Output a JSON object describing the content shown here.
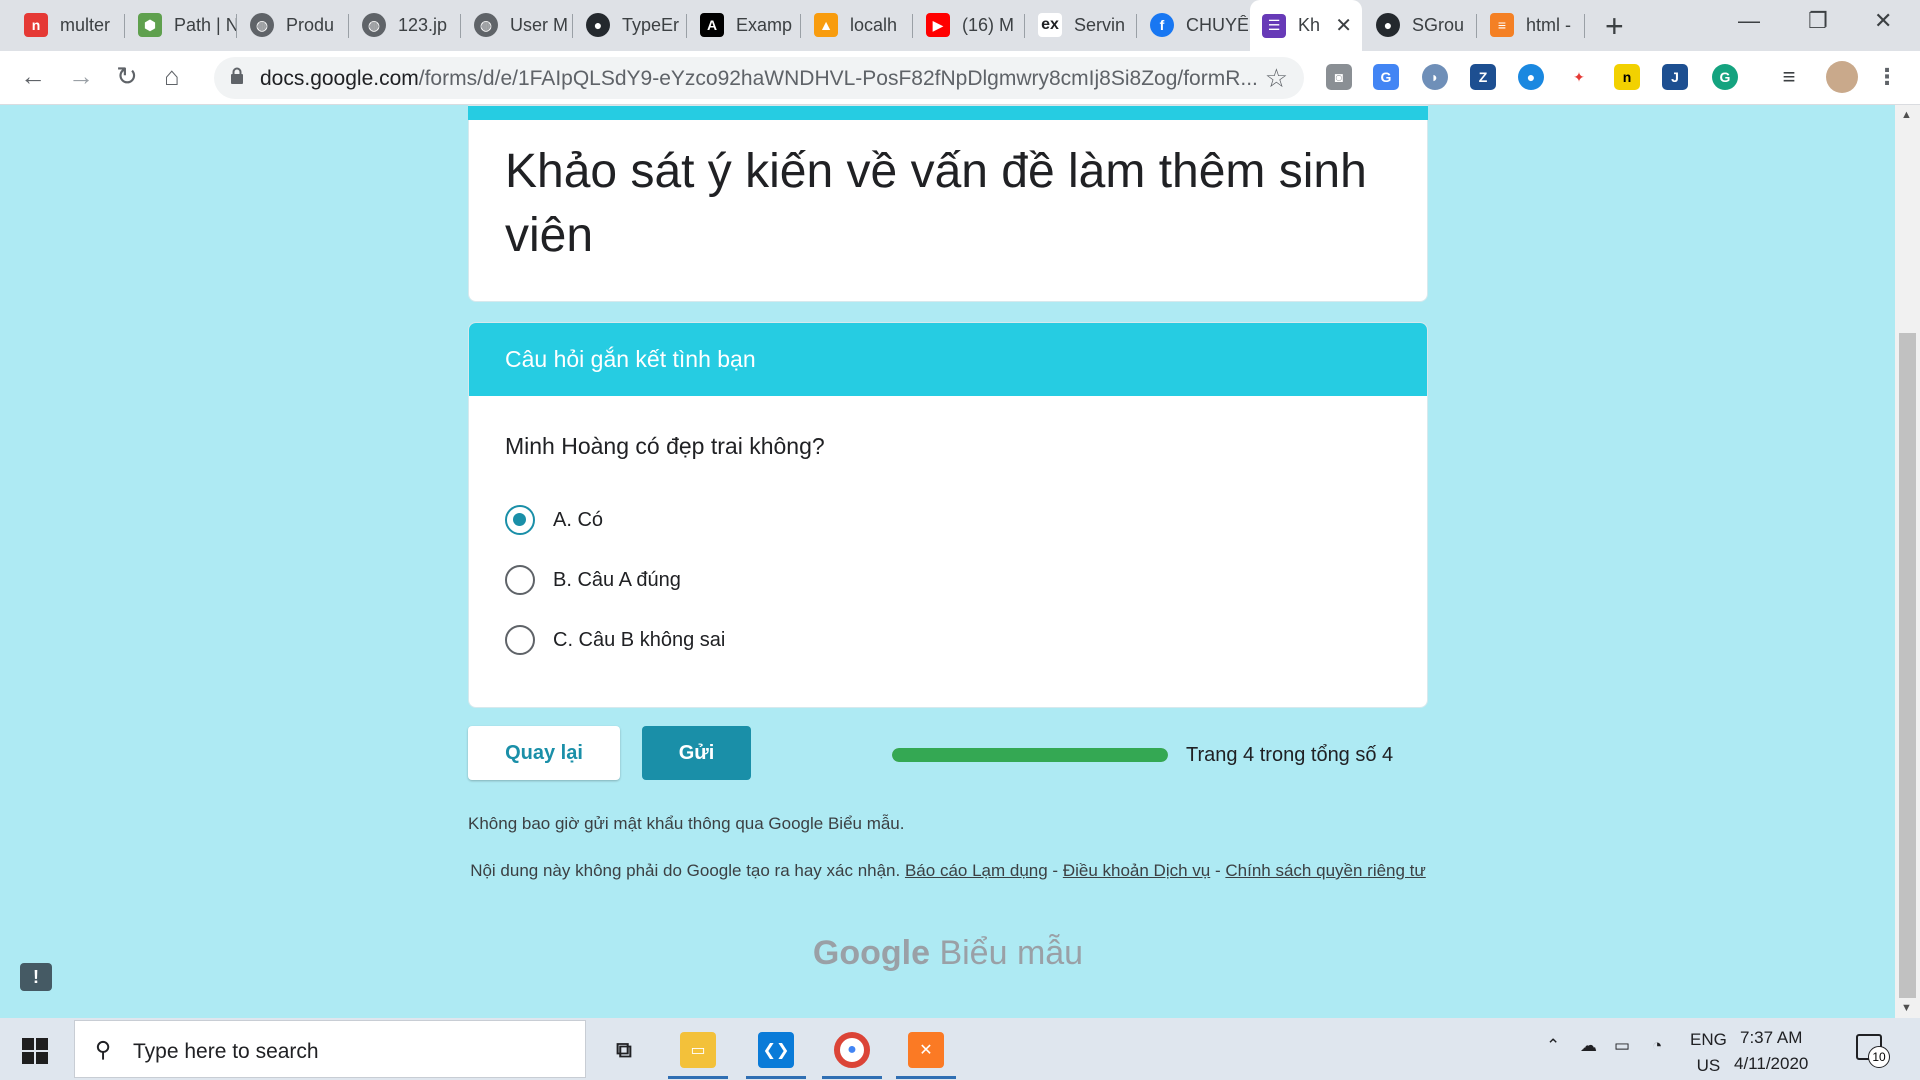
{
  "browser": {
    "tabs": [
      {
        "title": "multer",
        "icon": "red-brand-icon",
        "color": "#e53935",
        "glyph": "n"
      },
      {
        "title": "Path | N",
        "icon": "nodejs-icon",
        "color": "#5fa04e",
        "glyph": "⬢"
      },
      {
        "title": "Produ",
        "icon": "globe-icon",
        "color": "#5f6368",
        "glyph": "◍"
      },
      {
        "title": "123.jp",
        "icon": "globe-icon",
        "color": "#5f6368",
        "glyph": "◍"
      },
      {
        "title": "User M",
        "icon": "globe-icon",
        "color": "#5f6368",
        "glyph": "◍"
      },
      {
        "title": "TypeEr",
        "icon": "github-icon",
        "color": "#24292e",
        "glyph": "●"
      },
      {
        "title": "Examp",
        "icon": "a-brand-icon",
        "color": "#000000",
        "glyph": "A"
      },
      {
        "title": "localh",
        "icon": "phpmyadmin-icon",
        "color": "#f89c0e",
        "glyph": "▲"
      },
      {
        "title": "(16) M",
        "icon": "youtube-icon",
        "color": "#ff0000",
        "glyph": "▶"
      },
      {
        "title": "Servin",
        "icon": "ex-icon",
        "color": "#ffffff",
        "glyph": "ex"
      },
      {
        "title": "CHUYÊ",
        "icon": "facebook-icon",
        "color": "#1877f2",
        "glyph": "f"
      },
      {
        "title": "Kh",
        "icon": "google-forms-icon",
        "color": "#673ab7",
        "glyph": "☰",
        "active": true
      },
      {
        "title": "SGrou",
        "icon": "github-icon",
        "color": "#24292e",
        "glyph": "●"
      },
      {
        "title": "html -",
        "icon": "stackoverflow-icon",
        "color": "#f48024",
        "glyph": "≡"
      }
    ],
    "url_host": "docs.google.com",
    "url_path": "/forms/d/e/1FAIpQLSdY9-eYzco92haWNDHVL-PosF82fNpDlgmwry8cmIj8Si8Zog/formR..."
  },
  "form": {
    "title": "Khảo sát ý kiến về vấn đề làm thêm sinh viên",
    "section_title": "Câu hỏi gắn kết tình bạn",
    "question": "Minh Hoàng có đẹp trai không?",
    "options": [
      {
        "label": "A. Có",
        "selected": true
      },
      {
        "label": "B. Câu A đúng",
        "selected": false
      },
      {
        "label": "C. Câu B không sai",
        "selected": false
      }
    ],
    "back_label": "Quay lại",
    "submit_label": "Gửi",
    "progress_fraction": 1.0,
    "progress_text": "Trang 4 trong tổng số 4",
    "password_warning": "Không bao giờ gửi mật khẩu thông qua Google Biểu mẫu.",
    "disclaimer_text": "Nội dung này không phải do Google tạo ra hay xác nhận.",
    "link_report": "Báo cáo Lạm dụng",
    "link_terms": "Điều khoản Dịch vụ",
    "link_privacy": "Chính sách quyền riêng tư",
    "separator": "-",
    "brand_google": "Google",
    "brand_product": "Biểu mẫu",
    "feedback_glyph": "!"
  },
  "taskbar": {
    "search_placeholder": "Type here to search",
    "language_top": "ENG",
    "language_bottom": "US",
    "time": "7:37 AM",
    "date": "4/11/2020",
    "notification_count": "10"
  },
  "colors": {
    "accent": "#26cce2",
    "button": "#1a8fa8",
    "progress": "#34a853",
    "page_bg": "#aeeaf3"
  }
}
